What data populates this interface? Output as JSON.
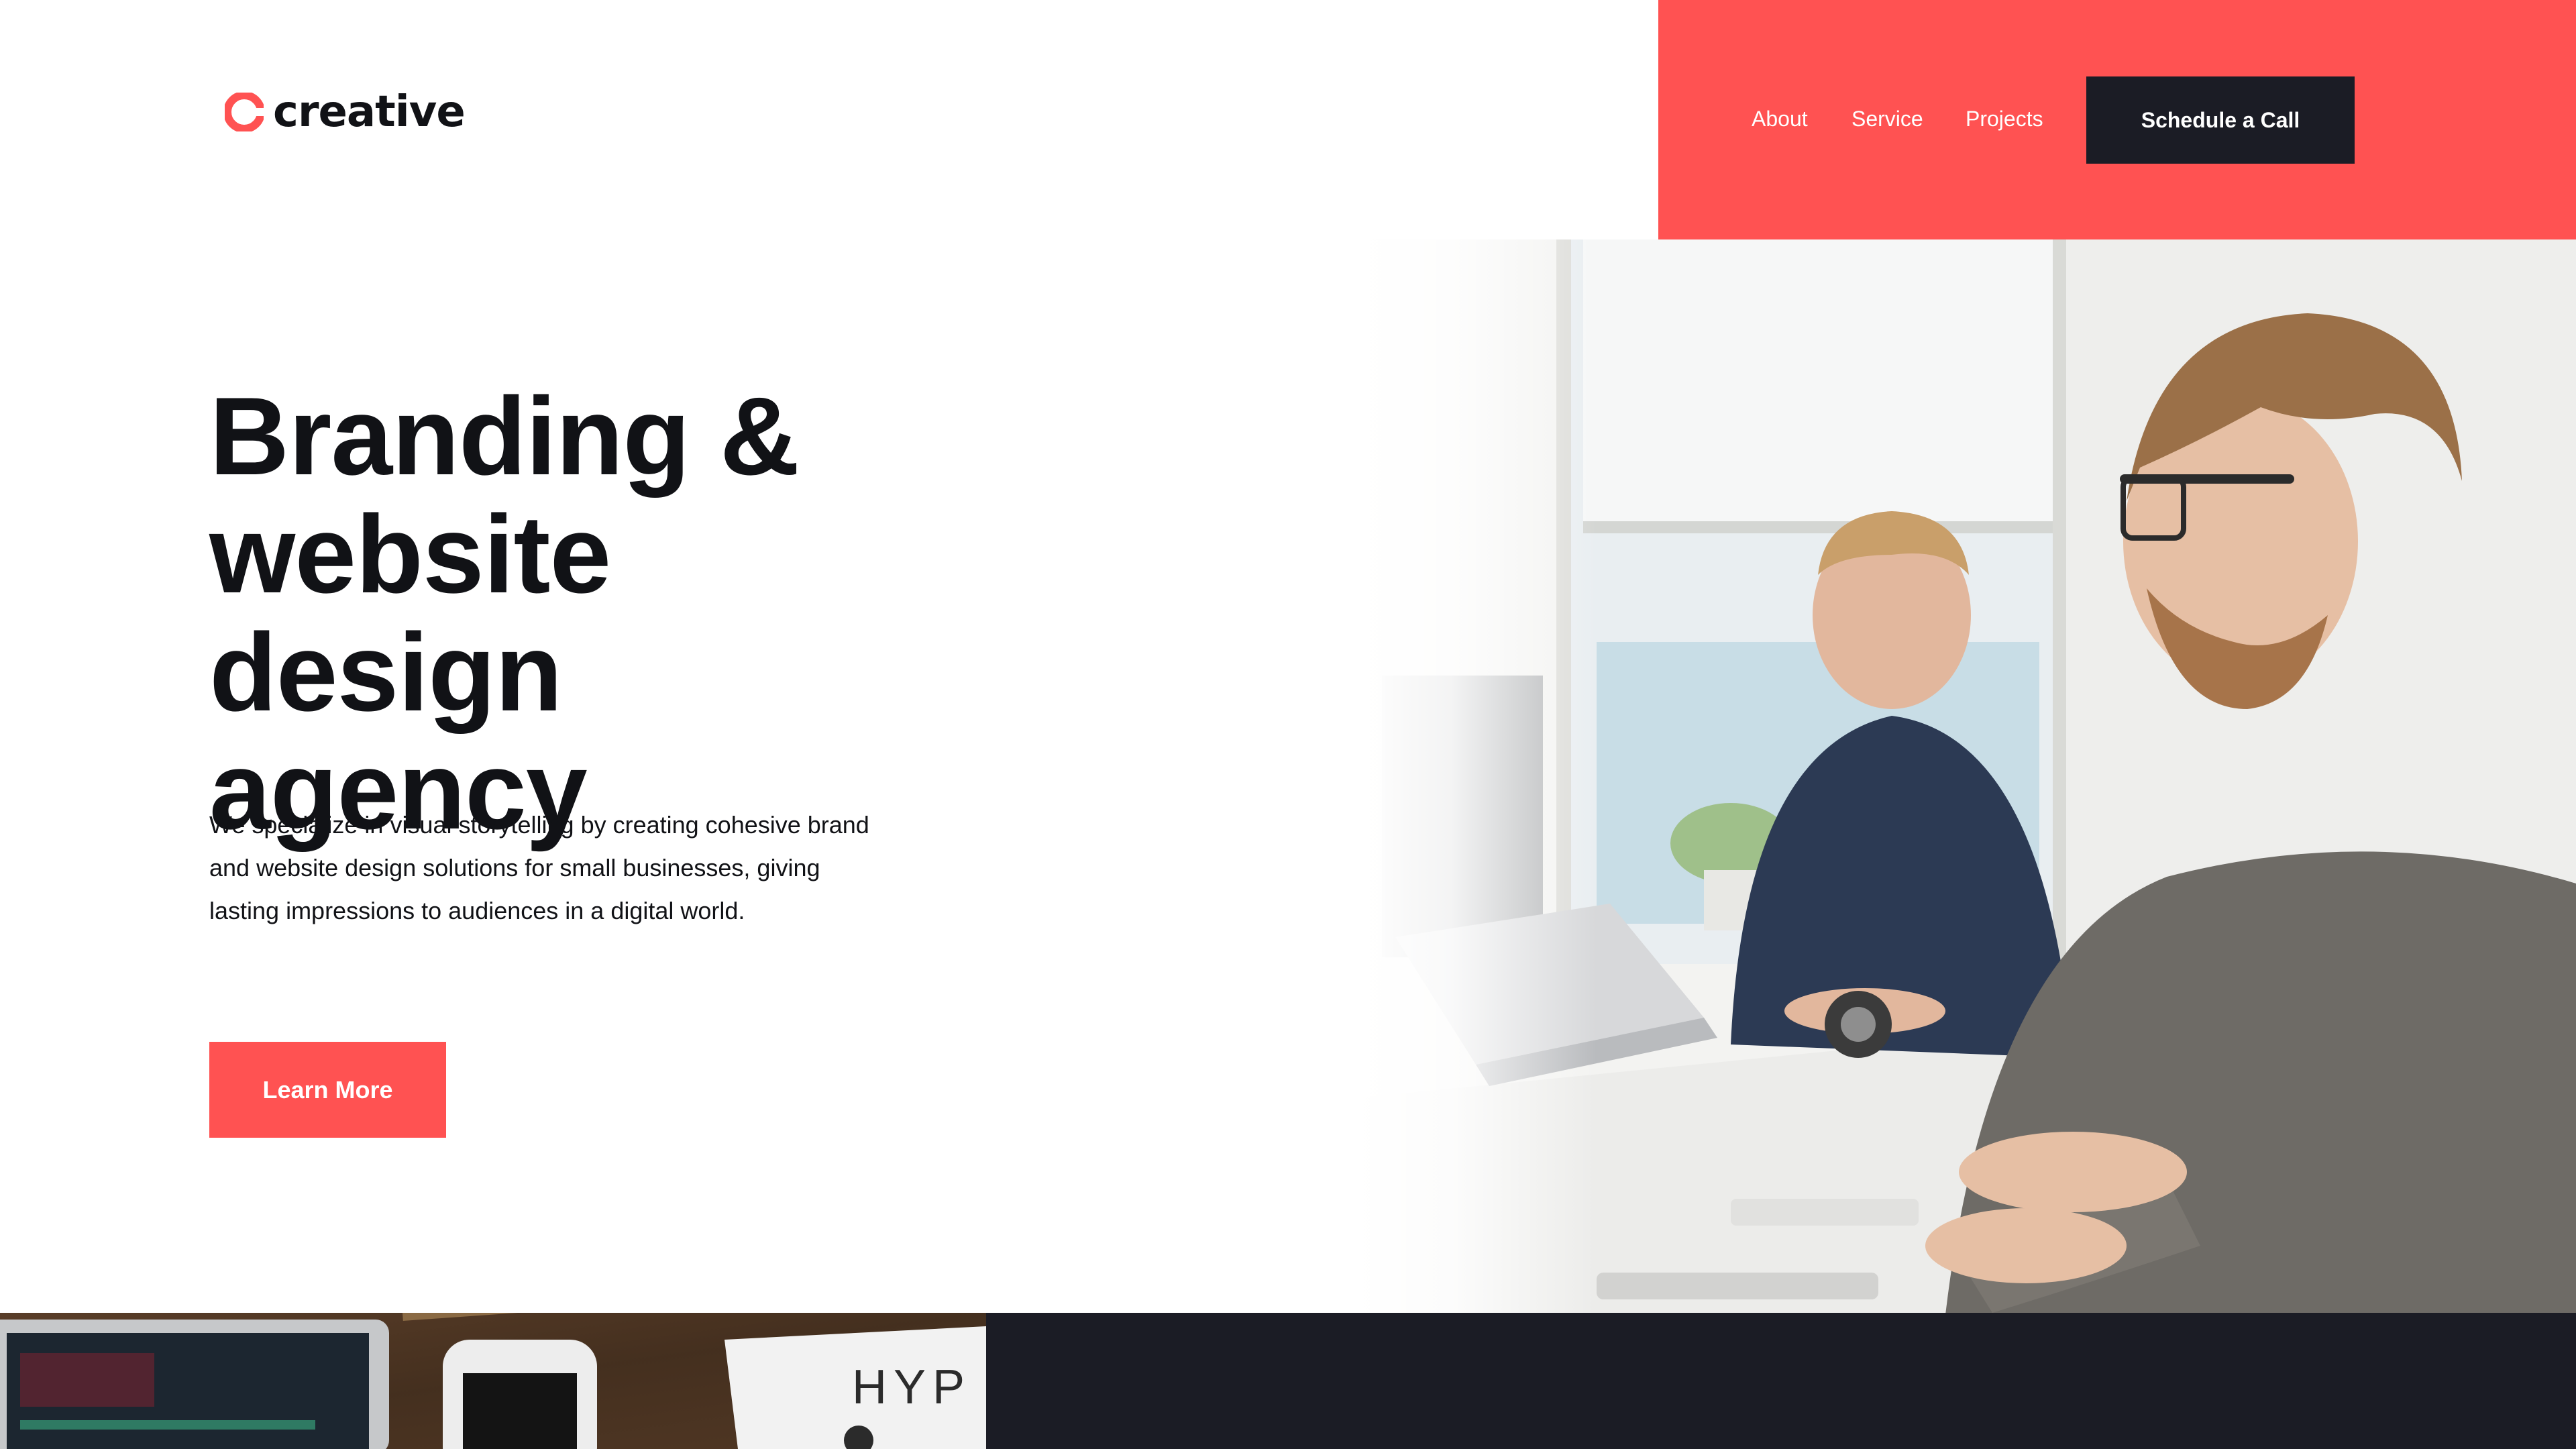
{
  "brand": {
    "name": "creative",
    "accent_color": "#ff5252",
    "dark_color": "#1b1c25"
  },
  "nav": {
    "links": [
      "About",
      "Service",
      "Projects"
    ],
    "cta_label": "Schedule a Call"
  },
  "hero": {
    "title": "Branding & website design agency",
    "description": "We specialize in visual storytelling by creating cohesive brand and website design solutions for small businesses, giving lasting impressions to audiences in a digital world.",
    "button_label": "Learn More",
    "photo_icon": "office-designers-photo"
  },
  "bottom": {
    "photo_text": "HYP"
  }
}
